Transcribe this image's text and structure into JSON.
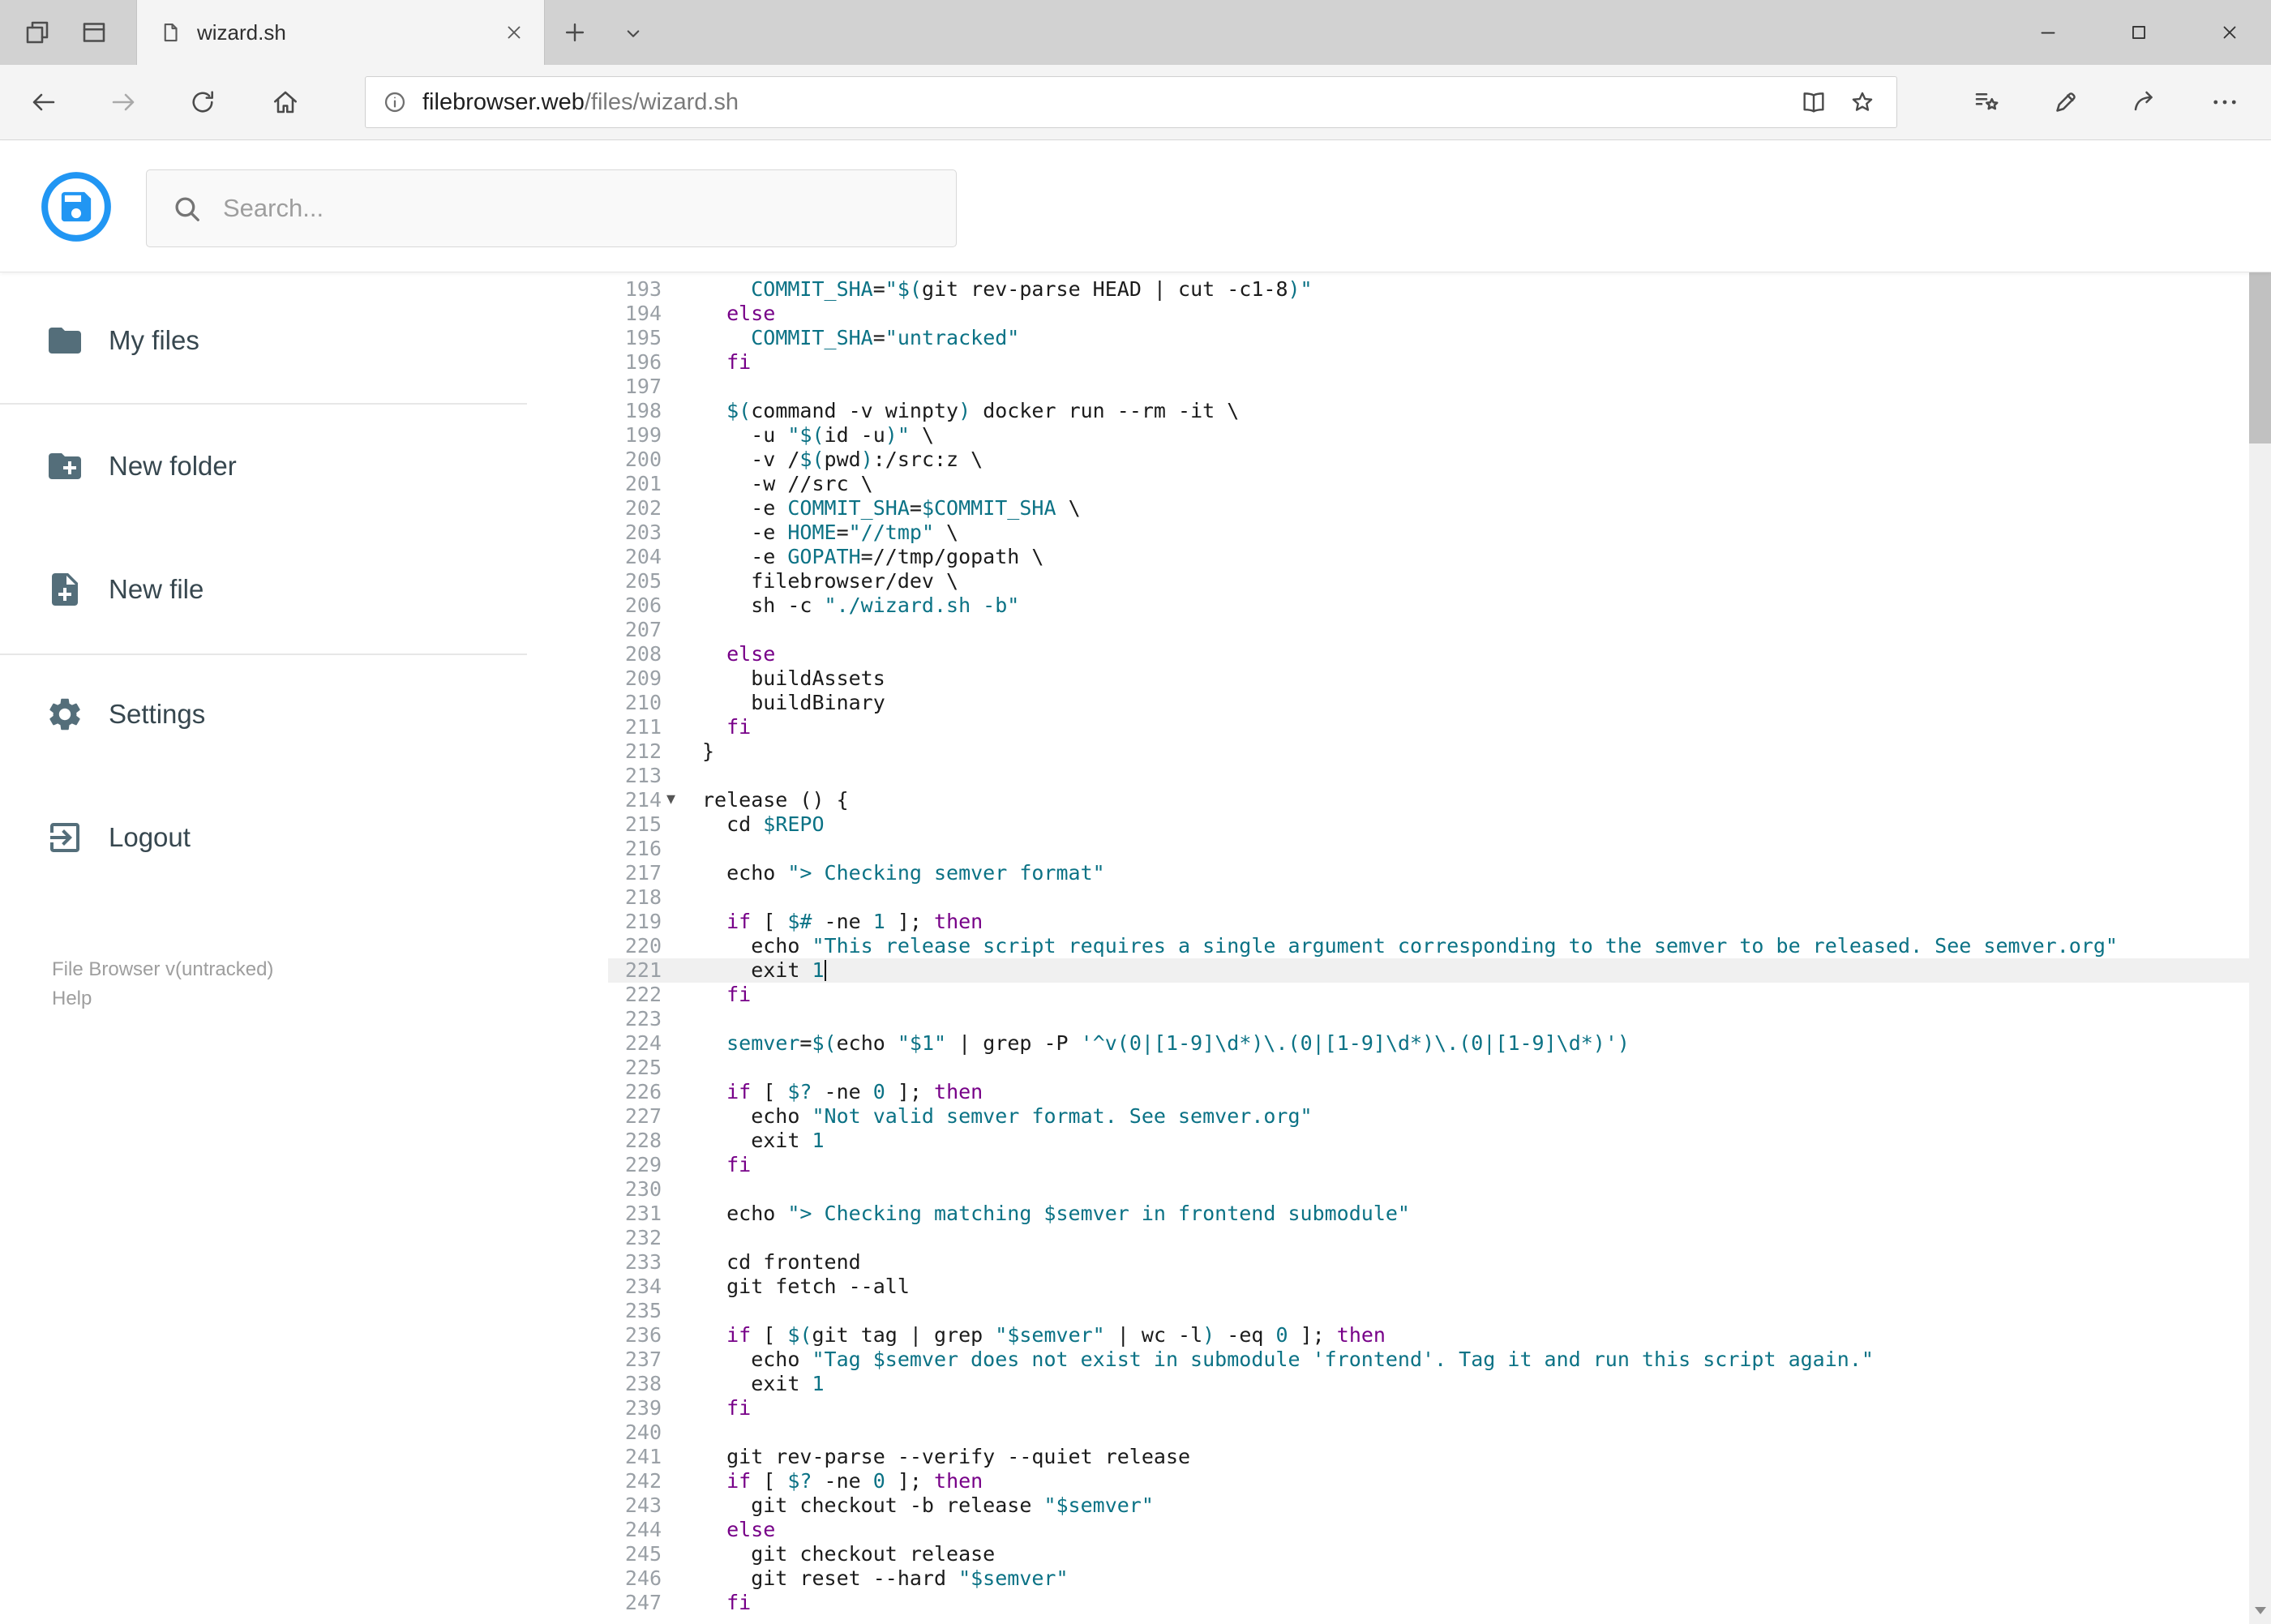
{
  "colors": {
    "accent": "#2196f3",
    "icon": "#5f6b73",
    "active-line": "#f0f0f0",
    "tok-t": "#1b1b1b",
    "tok-k": "#770088",
    "tok-s": "#0b7285",
    "tok-v": "#0b7285",
    "tok-n": "#0b7285"
  },
  "chrome": {
    "tab_title": "wizard.sh",
    "url_host": "filebrowser.web",
    "url_path": "/files/wizard.sh"
  },
  "header": {
    "search_placeholder": "Search...",
    "actions": [
      "save",
      "share",
      "edit",
      "copy",
      "move",
      "delete",
      "raw",
      "download",
      "info"
    ]
  },
  "sidebar": {
    "items": [
      {
        "id": "my-files",
        "label": "My files",
        "icon": "folder"
      },
      {
        "id": "new-folder",
        "label": "New folder",
        "icon": "create-new-folder"
      },
      {
        "id": "new-file",
        "label": "New file",
        "icon": "note-add"
      },
      {
        "id": "settings",
        "label": "Settings",
        "icon": "settings-gear"
      },
      {
        "id": "logout",
        "label": "Logout",
        "icon": "logout"
      }
    ],
    "footer_version": "File Browser v(untracked)",
    "footer_help": "Help"
  },
  "editor": {
    "active_line": 221,
    "fold_lines": [
      214
    ],
    "lines": [
      {
        "n": 193,
        "t": [
          [
            "t",
            "    "
          ],
          [
            "v",
            "COMMIT_SHA"
          ],
          [
            "t",
            "="
          ],
          [
            "s",
            "\"$("
          ],
          [
            "t",
            "git rev-parse HEAD | cut -c1-8"
          ],
          [
            "s",
            ")\""
          ]
        ]
      },
      {
        "n": 194,
        "t": [
          [
            "t",
            "  "
          ],
          [
            "k",
            "else"
          ]
        ]
      },
      {
        "n": 195,
        "t": [
          [
            "t",
            "    "
          ],
          [
            "v",
            "COMMIT_SHA"
          ],
          [
            "t",
            "="
          ],
          [
            "s",
            "\"untracked\""
          ]
        ]
      },
      {
        "n": 196,
        "t": [
          [
            "t",
            "  "
          ],
          [
            "k",
            "fi"
          ]
        ]
      },
      {
        "n": 197,
        "t": []
      },
      {
        "n": 198,
        "t": [
          [
            "t",
            "  "
          ],
          [
            "s",
            "$("
          ],
          [
            "t",
            "command -v winpty"
          ],
          [
            "s",
            ")"
          ],
          [
            "t",
            " docker run --rm -it \\"
          ]
        ]
      },
      {
        "n": 199,
        "t": [
          [
            "t",
            "    -u "
          ],
          [
            "s",
            "\"$("
          ],
          [
            "t",
            "id -u"
          ],
          [
            "s",
            ")\""
          ],
          [
            "t",
            " \\"
          ]
        ]
      },
      {
        "n": 200,
        "t": [
          [
            "t",
            "    -v /"
          ],
          [
            "s",
            "$("
          ],
          [
            "t",
            "pwd"
          ],
          [
            "s",
            ")"
          ],
          [
            "t",
            ":/src:z \\"
          ]
        ]
      },
      {
        "n": 201,
        "t": [
          [
            "t",
            "    -w //src \\"
          ]
        ]
      },
      {
        "n": 202,
        "t": [
          [
            "t",
            "    -e "
          ],
          [
            "v",
            "COMMIT_SHA"
          ],
          [
            "t",
            "="
          ],
          [
            "v",
            "$COMMIT_SHA"
          ],
          [
            "t",
            " \\"
          ]
        ]
      },
      {
        "n": 203,
        "t": [
          [
            "t",
            "    -e "
          ],
          [
            "v",
            "HOME"
          ],
          [
            "t",
            "="
          ],
          [
            "s",
            "\"//tmp\""
          ],
          [
            "t",
            " \\"
          ]
        ]
      },
      {
        "n": 204,
        "t": [
          [
            "t",
            "    -e "
          ],
          [
            "v",
            "GOPATH"
          ],
          [
            "t",
            "=//tmp/gopath \\"
          ]
        ]
      },
      {
        "n": 205,
        "t": [
          [
            "t",
            "    filebrowser/dev \\"
          ]
        ]
      },
      {
        "n": 206,
        "t": [
          [
            "t",
            "    sh -c "
          ],
          [
            "s",
            "\"./wizard.sh -b\""
          ]
        ]
      },
      {
        "n": 207,
        "t": []
      },
      {
        "n": 208,
        "t": [
          [
            "t",
            "  "
          ],
          [
            "k",
            "else"
          ]
        ]
      },
      {
        "n": 209,
        "t": [
          [
            "t",
            "    buildAssets"
          ]
        ]
      },
      {
        "n": 210,
        "t": [
          [
            "t",
            "    buildBinary"
          ]
        ]
      },
      {
        "n": 211,
        "t": [
          [
            "t",
            "  "
          ],
          [
            "k",
            "fi"
          ]
        ]
      },
      {
        "n": 212,
        "t": [
          [
            "t",
            "}"
          ]
        ]
      },
      {
        "n": 213,
        "t": []
      },
      {
        "n": 214,
        "t": [
          [
            "t",
            "release () {"
          ]
        ]
      },
      {
        "n": 215,
        "t": [
          [
            "t",
            "  cd "
          ],
          [
            "v",
            "$REPO"
          ]
        ]
      },
      {
        "n": 216,
        "t": []
      },
      {
        "n": 217,
        "t": [
          [
            "t",
            "  echo "
          ],
          [
            "s",
            "\"> Checking semver format\""
          ]
        ]
      },
      {
        "n": 218,
        "t": []
      },
      {
        "n": 219,
        "t": [
          [
            "t",
            "  "
          ],
          [
            "k",
            "if"
          ],
          [
            "t",
            " [ "
          ],
          [
            "v",
            "$#"
          ],
          [
            "t",
            " -ne "
          ],
          [
            "n",
            "1"
          ],
          [
            "t",
            " ]; "
          ],
          [
            "k",
            "then"
          ]
        ]
      },
      {
        "n": 220,
        "t": [
          [
            "t",
            "    echo "
          ],
          [
            "s",
            "\"This release script requires a single argument corresponding to the semver to be released. See semver.org\""
          ]
        ]
      },
      {
        "n": 221,
        "t": [
          [
            "t",
            "    exit "
          ],
          [
            "n",
            "1"
          ]
        ]
      },
      {
        "n": 222,
        "t": [
          [
            "t",
            "  "
          ],
          [
            "k",
            "fi"
          ]
        ]
      },
      {
        "n": 223,
        "t": []
      },
      {
        "n": 224,
        "t": [
          [
            "t",
            "  "
          ],
          [
            "v",
            "semver"
          ],
          [
            "t",
            "="
          ],
          [
            "s",
            "$("
          ],
          [
            "t",
            "echo "
          ],
          [
            "s",
            "\"$1\""
          ],
          [
            "t",
            " | grep -P "
          ],
          [
            "s",
            "'^v(0|[1-9]\\d*)\\.(0|[1-9]\\d*)\\.(0|[1-9]\\d*)'"
          ],
          [
            "s",
            ")"
          ]
        ]
      },
      {
        "n": 225,
        "t": []
      },
      {
        "n": 226,
        "t": [
          [
            "t",
            "  "
          ],
          [
            "k",
            "if"
          ],
          [
            "t",
            " [ "
          ],
          [
            "v",
            "$?"
          ],
          [
            "t",
            " -ne "
          ],
          [
            "n",
            "0"
          ],
          [
            "t",
            " ]; "
          ],
          [
            "k",
            "then"
          ]
        ]
      },
      {
        "n": 227,
        "t": [
          [
            "t",
            "    echo "
          ],
          [
            "s",
            "\"Not valid semver format. See semver.org\""
          ]
        ]
      },
      {
        "n": 228,
        "t": [
          [
            "t",
            "    exit "
          ],
          [
            "n",
            "1"
          ]
        ]
      },
      {
        "n": 229,
        "t": [
          [
            "t",
            "  "
          ],
          [
            "k",
            "fi"
          ]
        ]
      },
      {
        "n": 230,
        "t": []
      },
      {
        "n": 231,
        "t": [
          [
            "t",
            "  echo "
          ],
          [
            "s",
            "\"> Checking matching $semver in frontend submodule\""
          ]
        ]
      },
      {
        "n": 232,
        "t": []
      },
      {
        "n": 233,
        "t": [
          [
            "t",
            "  cd frontend"
          ]
        ]
      },
      {
        "n": 234,
        "t": [
          [
            "t",
            "  git fetch --all"
          ]
        ]
      },
      {
        "n": 235,
        "t": []
      },
      {
        "n": 236,
        "t": [
          [
            "t",
            "  "
          ],
          [
            "k",
            "if"
          ],
          [
            "t",
            " [ "
          ],
          [
            "s",
            "$("
          ],
          [
            "t",
            "git tag | grep "
          ],
          [
            "s",
            "\"$semver\""
          ],
          [
            "t",
            " | wc -l"
          ],
          [
            "s",
            ")"
          ],
          [
            "t",
            " -eq "
          ],
          [
            "n",
            "0"
          ],
          [
            "t",
            " ]; "
          ],
          [
            "k",
            "then"
          ]
        ]
      },
      {
        "n": 237,
        "t": [
          [
            "t",
            "    echo "
          ],
          [
            "s",
            "\"Tag $semver does not exist in submodule 'frontend'. Tag it and run this script again.\""
          ]
        ]
      },
      {
        "n": 238,
        "t": [
          [
            "t",
            "    exit "
          ],
          [
            "n",
            "1"
          ]
        ]
      },
      {
        "n": 239,
        "t": [
          [
            "t",
            "  "
          ],
          [
            "k",
            "fi"
          ]
        ]
      },
      {
        "n": 240,
        "t": []
      },
      {
        "n": 241,
        "t": [
          [
            "t",
            "  git rev-parse --verify --quiet release"
          ]
        ]
      },
      {
        "n": 242,
        "t": [
          [
            "t",
            "  "
          ],
          [
            "k",
            "if"
          ],
          [
            "t",
            " [ "
          ],
          [
            "v",
            "$?"
          ],
          [
            "t",
            " -ne "
          ],
          [
            "n",
            "0"
          ],
          [
            "t",
            " ]; "
          ],
          [
            "k",
            "then"
          ]
        ]
      },
      {
        "n": 243,
        "t": [
          [
            "t",
            "    git checkout -b release "
          ],
          [
            "s",
            "\"$semver\""
          ]
        ]
      },
      {
        "n": 244,
        "t": [
          [
            "t",
            "  "
          ],
          [
            "k",
            "else"
          ]
        ]
      },
      {
        "n": 245,
        "t": [
          [
            "t",
            "    git checkout release"
          ]
        ]
      },
      {
        "n": 246,
        "t": [
          [
            "t",
            "    git reset --hard "
          ],
          [
            "s",
            "\"$semver\""
          ]
        ]
      },
      {
        "n": 247,
        "t": [
          [
            "t",
            "  "
          ],
          [
            "k",
            "fi"
          ]
        ]
      }
    ]
  }
}
